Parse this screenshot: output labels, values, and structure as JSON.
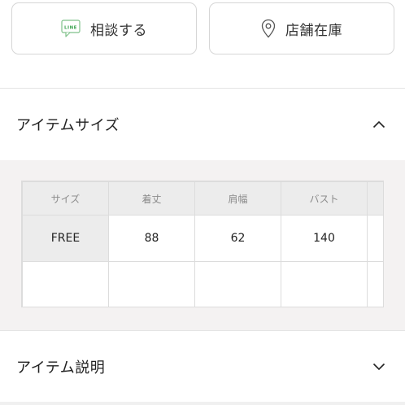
{
  "actions": {
    "consult_label": "相談する",
    "line_badge": "LINE",
    "store_stock_label": "店舗在庫"
  },
  "item_size": {
    "title": "アイテムサイズ",
    "columns": [
      "サイズ",
      "着丈",
      "肩幅",
      "バスト",
      ""
    ],
    "rows": [
      [
        "FREE",
        "88",
        "62",
        "140",
        ""
      ],
      [
        "",
        "",
        "",
        "",
        ""
      ]
    ]
  },
  "item_description": {
    "title": "アイテム説明"
  }
}
